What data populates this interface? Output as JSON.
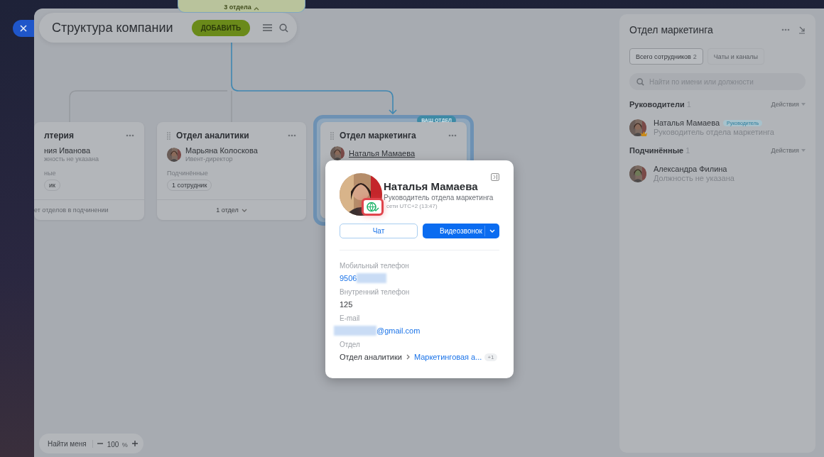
{
  "header": {
    "title": "Структура компании",
    "add_button": "ДОБАВИТЬ"
  },
  "top_node": {
    "footer": "3 отдела"
  },
  "departments": [
    {
      "title": "лтерия",
      "highlighted": false,
      "head": {
        "name": "ния Иванова",
        "position": "жность не указана",
        "photo": false
      },
      "subordinates_label": "ные",
      "subordinates_count": "ик",
      "footer": "ет отделов в подчинении",
      "footer_caret": false
    },
    {
      "title": "Отдел аналитики",
      "highlighted": false,
      "head": {
        "name": "Марьяна Колоскова",
        "position": "Ивент-директор",
        "photo": true
      },
      "subordinates_label": "Подчинённые",
      "subordinates_count": "1 сотрудник",
      "footer": "1 отдел",
      "footer_caret": true
    },
    {
      "title": "Отдел маркетинга",
      "highlighted": true,
      "badge": "ВАШ ОТДЕЛ",
      "head": {
        "name": "Наталья Мамаева",
        "photo": true
      }
    }
  ],
  "popup": {
    "name": "Наталья Мамаева",
    "position": "Руководитель отдела маркетинга",
    "status": "сети UTC+2 (13:47)",
    "chat_button": "Чат",
    "call_button": "Видеозвонок",
    "fields": [
      {
        "label": "Мобильный телефон",
        "kind": "link_blur_after",
        "value": "9506"
      },
      {
        "label": "Внутренний телефон",
        "kind": "text",
        "value": "125"
      },
      {
        "label": "E-mail",
        "kind": "link_blur_before",
        "value": "@gmail.com"
      },
      {
        "label": "Отдел",
        "kind": "path",
        "parts": [
          "Отдел аналитики",
          "Маркетинговая а..."
        ],
        "extra": "+1"
      }
    ]
  },
  "side_panel": {
    "title": "Отдел маркетинга",
    "tabs": [
      {
        "label": "Всего сотрудников",
        "count": "2",
        "selected": true
      },
      {
        "label": "Чаты и каналы",
        "selected": false
      }
    ],
    "search": {
      "placeholder": "Найти по имени или должности"
    },
    "sections": [
      {
        "title": "Руководители",
        "count": "1",
        "action": "Действия",
        "members": [
          {
            "name": "Наталья Мамаева",
            "tag": "Руководитель",
            "position": "Руководитель отдела маркетинга",
            "crown": true
          }
        ]
      },
      {
        "title": "Подчинённые",
        "count": "1",
        "action": "Действия",
        "members": [
          {
            "name": "Александра Филина",
            "position": "Должность не указана",
            "crown": false
          }
        ]
      }
    ]
  },
  "zoom": {
    "find_me": "Найти меня",
    "value": "100",
    "unit": "%"
  }
}
